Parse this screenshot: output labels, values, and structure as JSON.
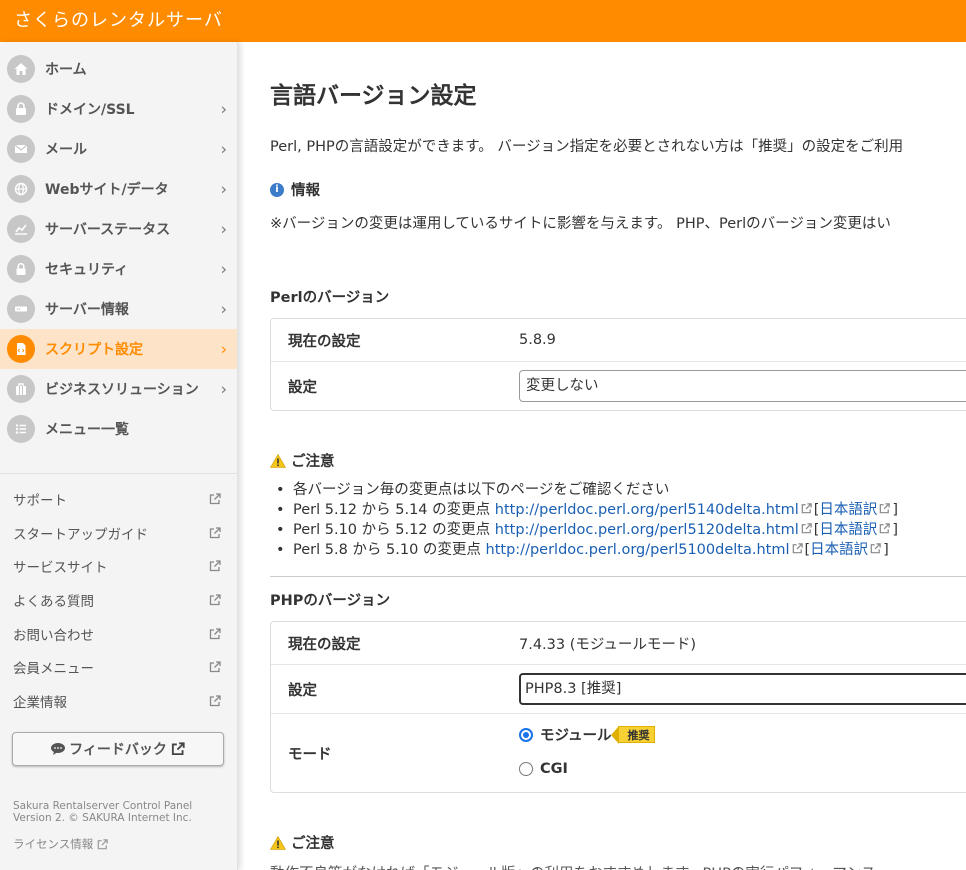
{
  "app": {
    "title": "さくらのレンタルサーバ"
  },
  "sidebar": {
    "items": [
      {
        "label": "ホーム",
        "icon": "home-icon"
      },
      {
        "label": "ドメイン/SSL",
        "icon": "lock-icon"
      },
      {
        "label": "メール",
        "icon": "mail-icon"
      },
      {
        "label": "Webサイト/データ",
        "icon": "globe-icon"
      },
      {
        "label": "サーバーステータス",
        "icon": "chart-icon"
      },
      {
        "label": "セキュリティ",
        "icon": "padlock-icon"
      },
      {
        "label": "サーバー情報",
        "icon": "server-icon"
      },
      {
        "label": "スクリプト設定",
        "icon": "script-file-icon"
      },
      {
        "label": "ビジネスソリューション",
        "icon": "briefcase-icon"
      },
      {
        "label": "メニュー一覧",
        "icon": "list-icon"
      }
    ],
    "active_index": 7,
    "links": [
      "サポート",
      "スタートアップガイド",
      "サービスサイト",
      "よくある質問",
      "お問い合わせ",
      "会員メニュー",
      "企業情報"
    ],
    "feedback_label": "フィードバック",
    "footer_line1": "Sakura Rentalserver Control Panel",
    "footer_line2": "Version 2. © SAKURA Internet Inc.",
    "license_label": "ライセンス情報"
  },
  "main": {
    "title": "言語バージョン設定",
    "description": "Perl, PHPの言語設定ができます。 バージョン指定を必要とされない方は「推奨」の設定をご利用",
    "info_heading": "情報",
    "info_text": "※バージョンの変更は運用しているサイトに影響を与えます。 PHP、Perlのバージョン変更はい",
    "perl": {
      "section_label": "Perlのバージョン",
      "current_label": "現在の設定",
      "current_value": "5.8.9",
      "setting_label": "設定",
      "setting_value": "変更しない",
      "notice_heading": "ご注意",
      "notes": [
        {
          "text": "各バージョン毎の変更点は以下のページをご確認ください"
        },
        {
          "text": "Perl 5.12 から 5.14 の変更点 ",
          "link": "http://perldoc.perl.org/perl5140delta.html",
          "ja": "日本語訳"
        },
        {
          "text": "Perl 5.10 から 5.12 の変更点 ",
          "link": "http://perldoc.perl.org/perl5120delta.html",
          "ja": "日本語訳"
        },
        {
          "text": "Perl 5.8 から 5.10 の変更点 ",
          "link": "http://perldoc.perl.org/perl5100delta.html",
          "ja": "日本語訳"
        }
      ]
    },
    "php": {
      "section_label": "PHPのバージョン",
      "current_label": "現在の設定",
      "current_value": "7.4.33 (モジュールモード)",
      "setting_label": "設定",
      "setting_value": "PHP8.3 [推奨]",
      "mode_label": "モード",
      "mode_module": "モジュール",
      "recommend_badge": "推奨",
      "mode_cgi": "CGI",
      "notice_heading": "ご注意",
      "tail_text": "動作不良等がなければ「モジュール版」の利用をおすすめします。PHPの実行パフォーマンス"
    }
  },
  "colors": {
    "brand": "#ff8c00",
    "active_bg": "#fde3c7",
    "link": "#1a5fb4"
  }
}
